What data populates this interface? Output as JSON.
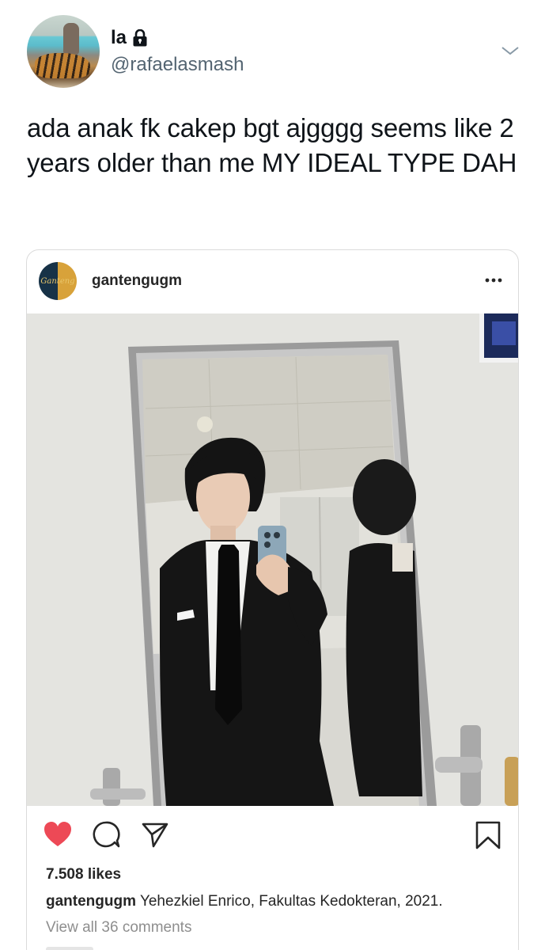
{
  "tweet": {
    "display_name": "la",
    "handle": "@rafaelasmash",
    "text": "ada anak fk cakep bgt ajgggg seems like 2 years older than me MY IDEAL TYPE DAH",
    "protected_icon": "lock-icon",
    "menu_icon": "chevron-down-icon"
  },
  "instagram_embed": {
    "username": "gantengugm",
    "avatar_text": "Ganteng",
    "more_icon": "more-dots-icon",
    "photo_icon": "photo",
    "actions": [
      "heart-filled-icon",
      "comment-icon",
      "share-icon",
      "bookmark-icon"
    ],
    "likes": "7.508 likes",
    "caption_user": "gantengugm",
    "caption_text": "Yehezkiel Enrico, Fakultas Kedokteran, 2021.",
    "view_comments": "View all 36 comments",
    "colors": {
      "heart": "#ed4956",
      "text": "#262626",
      "muted": "#8e8e8e",
      "border": "#dbdbdb"
    }
  }
}
